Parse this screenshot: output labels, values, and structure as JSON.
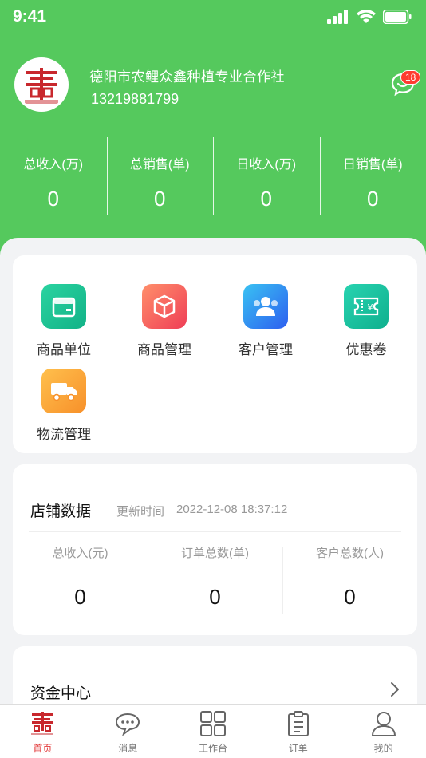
{
  "status_bar": {
    "time": "9:41"
  },
  "profile": {
    "shop_name": "德阳市农鲤众鑫种植专业合作社",
    "phone": "13219881799",
    "badge_count": "18"
  },
  "summary": [
    {
      "label": "总收入(万)",
      "value": "0"
    },
    {
      "label": "总销售(单)",
      "value": "0"
    },
    {
      "label": "日收入(万)",
      "value": "0"
    },
    {
      "label": "日销售(单)",
      "value": "0"
    }
  ],
  "menu": [
    {
      "label": "商品单位",
      "icon": "box-icon",
      "color": "#1fbf8f"
    },
    {
      "label": "商品管理",
      "icon": "package-icon",
      "color": "#f2535a"
    },
    {
      "label": "客户管理",
      "icon": "customers-icon",
      "color": "#2e7cf6"
    },
    {
      "label": "优惠卷",
      "icon": "coupon-icon",
      "color": "#19c6a0"
    },
    {
      "label": "物流管理",
      "icon": "truck-icon",
      "color": "#f9a13a"
    }
  ],
  "store": {
    "title": "店铺数据",
    "update_label": "更新时间",
    "update_time": "2022-12-08 18:37:12",
    "stats": [
      {
        "label": "总收入(元)",
        "value": "0"
      },
      {
        "label": "订单总数(单)",
        "value": "0"
      },
      {
        "label": "客户总数(人)",
        "value": "0"
      }
    ]
  },
  "fund": {
    "title": "资金中心"
  },
  "tabs": [
    {
      "label": "首页",
      "active": true
    },
    {
      "label": "消息"
    },
    {
      "label": "工作台"
    },
    {
      "label": "订单"
    },
    {
      "label": "我的"
    }
  ],
  "colors": {
    "brand_green": "#55c95d",
    "active_tab": "#e23838",
    "badge": "#ff3b30"
  }
}
